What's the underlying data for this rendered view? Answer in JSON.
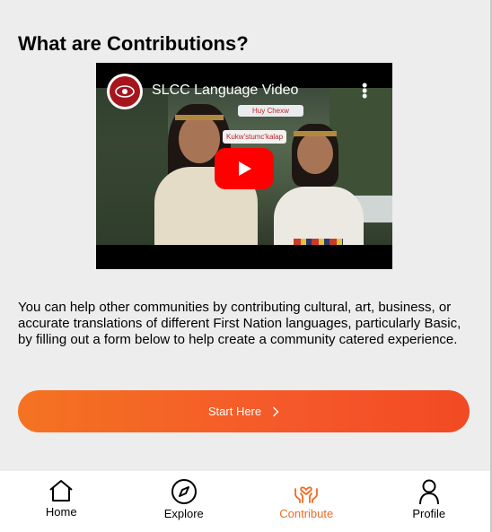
{
  "page": {
    "title": "What are Contributions?"
  },
  "video": {
    "title": "SLCC Language Video",
    "captions": [
      "Huy Chexw",
      "Kukw'stumc'kalap"
    ]
  },
  "description": "You can help other communities by contributing cultural, art, business, or accurate translations of different First Nation languages, particularly Basic, by filling out a form below to help create a community catered experience.",
  "cta": {
    "label": "Start Here"
  },
  "tabbar": {
    "active": "Contribute",
    "items": [
      {
        "label": "Home",
        "icon": "home-icon"
      },
      {
        "label": "Explore",
        "icon": "compass-icon"
      },
      {
        "label": "Contribute",
        "icon": "heart-hands-icon"
      },
      {
        "label": "Profile",
        "icon": "person-icon"
      }
    ]
  },
  "colors": {
    "accent": "#f26a22",
    "background": "#ededed",
    "youtube_red": "#ff0000"
  }
}
